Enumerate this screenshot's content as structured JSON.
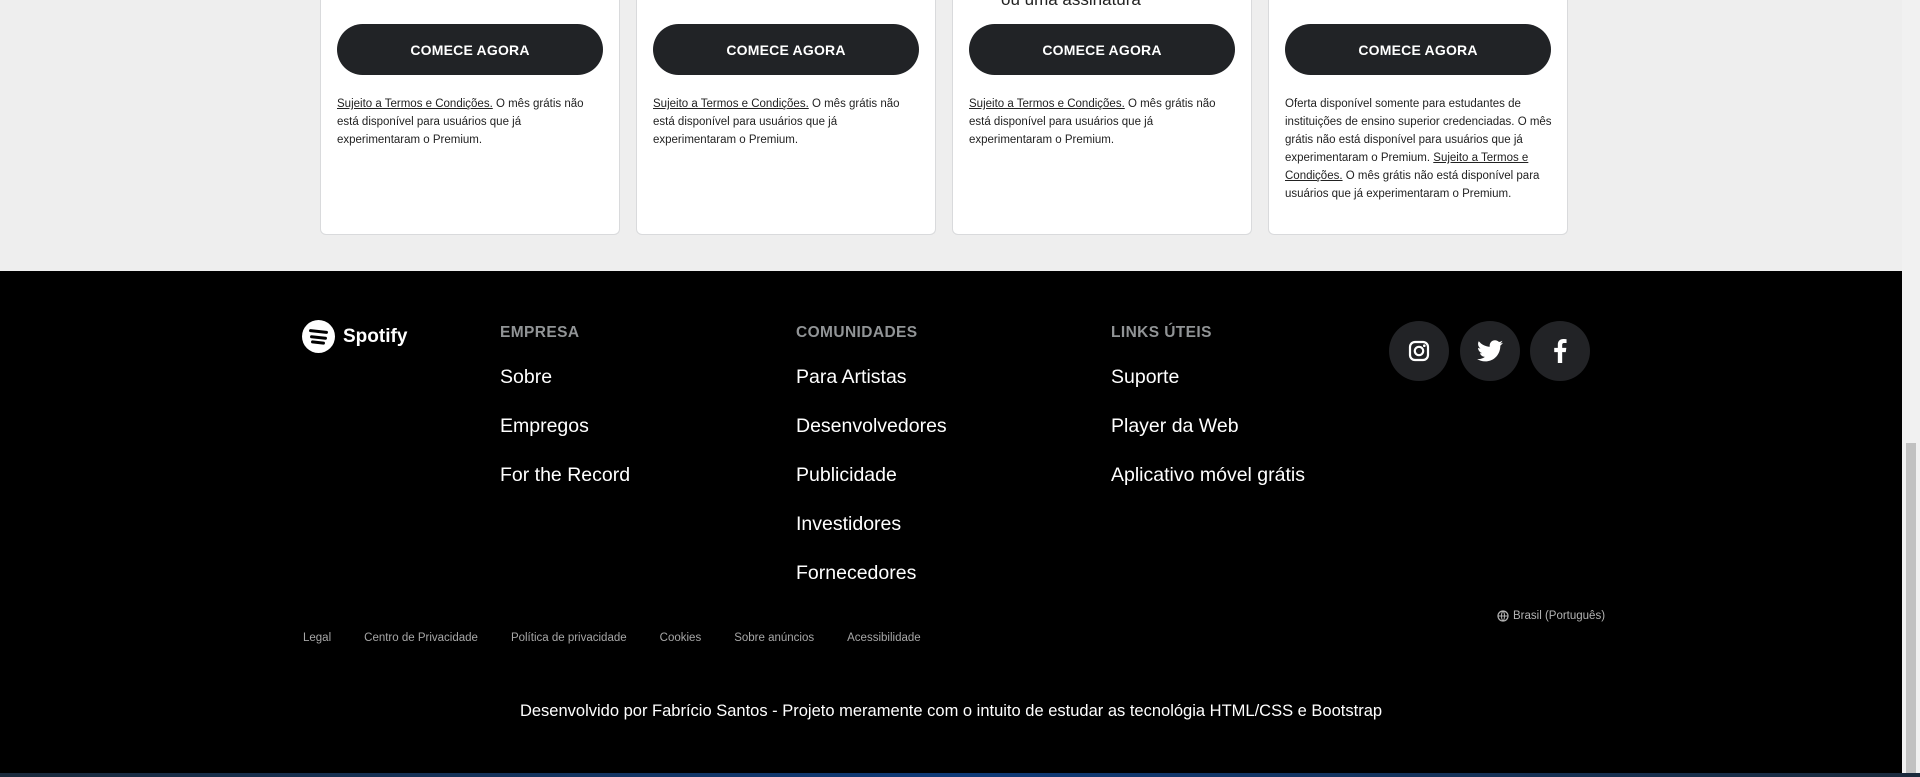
{
  "plans": [
    {
      "cut_text": "",
      "cta": "COMECE AGORA",
      "terms_link": "Sujeito a Termos e Condições.",
      "terms_text": " O mês grátis não está disponível para usuários que já experimentaram o Premium."
    },
    {
      "cut_text": "",
      "cta": "COMECE AGORA",
      "terms_link": "Sujeito a Termos e Condições.",
      "terms_text": " O mês grátis não está disponível para usuários que já experimentaram o Premium."
    },
    {
      "cut_text": "ou uma assinatura",
      "cta": "COMECE AGORA",
      "terms_link": "Sujeito a Termos e Condições.",
      "terms_text": " O mês grátis não está disponível para usuários que já experimentaram o Premium."
    },
    {
      "cut_text": "",
      "cta": "COMECE AGORA",
      "terms_pre": "Oferta disponível somente para estudantes de instituições de ensino superior credenciadas. O mês grátis não está disponível para usuários que já experimentaram o Premium. ",
      "terms_link": "Sujeito a Termos e Condições.",
      "terms_text": " O mês grátis não está disponível para usuários que já experimentaram o Premium."
    }
  ],
  "footer": {
    "brand": "Spotify",
    "columns": [
      {
        "title": "EMPRESA",
        "links": [
          "Sobre",
          "Empregos",
          "For the Record"
        ]
      },
      {
        "title": "COMUNIDADES",
        "links": [
          "Para Artistas",
          "Desenvolvedores",
          "Publicidade",
          "Investidores",
          "Fornecedores"
        ]
      },
      {
        "title": "LINKS ÚTEIS",
        "links": [
          "Suporte",
          "Player da Web",
          "Aplicativo móvel grátis"
        ]
      }
    ],
    "social": [
      "instagram-icon",
      "twitter-icon",
      "facebook-icon"
    ],
    "region": "Brasil (Português)",
    "legal": [
      "Legal",
      "Centro de Privacidade",
      "Política de privacidade",
      "Cookies",
      "Sobre anúncios",
      "Acessibilidade"
    ],
    "credit": "Desenvolvido por Fabrício Santos - Projeto meramente com o intuito de estudar as tecnológia HTML/CSS e Bootstrap"
  },
  "colors": {
    "button_bg": "#212326",
    "footer_bg": "#000000",
    "muted_heading": "#919496",
    "social_bg": "#222326"
  }
}
